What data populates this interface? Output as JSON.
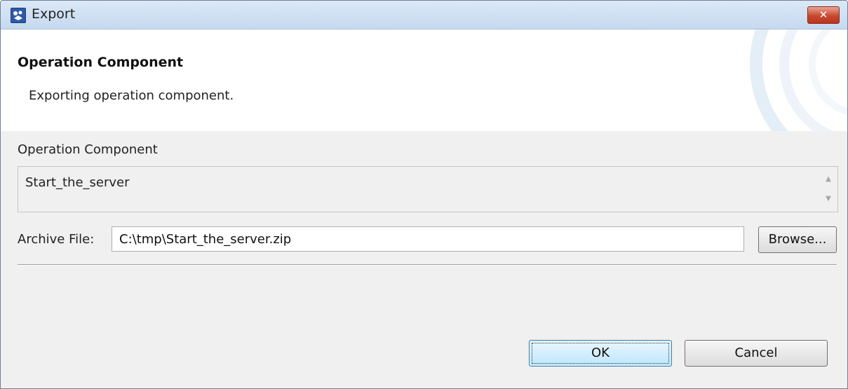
{
  "window": {
    "title": "Export",
    "close_label": "✕"
  },
  "banner": {
    "title": "Operation Component",
    "description": "Exporting operation component."
  },
  "component_section": {
    "label": "Operation Component",
    "items": [
      "Start_the_server"
    ]
  },
  "archive": {
    "label": "Archive File:",
    "value": "C:\\tmp\\Start_the_server.zip",
    "browse_label": "Browse..."
  },
  "buttons": {
    "ok_label": "OK",
    "cancel_label": "Cancel"
  },
  "icons": {
    "app": "eclipse-window-icon",
    "close": "close-icon",
    "scroll_up": "chevron-up-icon",
    "scroll_down": "chevron-down-icon"
  },
  "colors": {
    "titlebar": "#c6d9f0",
    "close_button": "#c8482f",
    "default_button": "#bee6fd"
  }
}
